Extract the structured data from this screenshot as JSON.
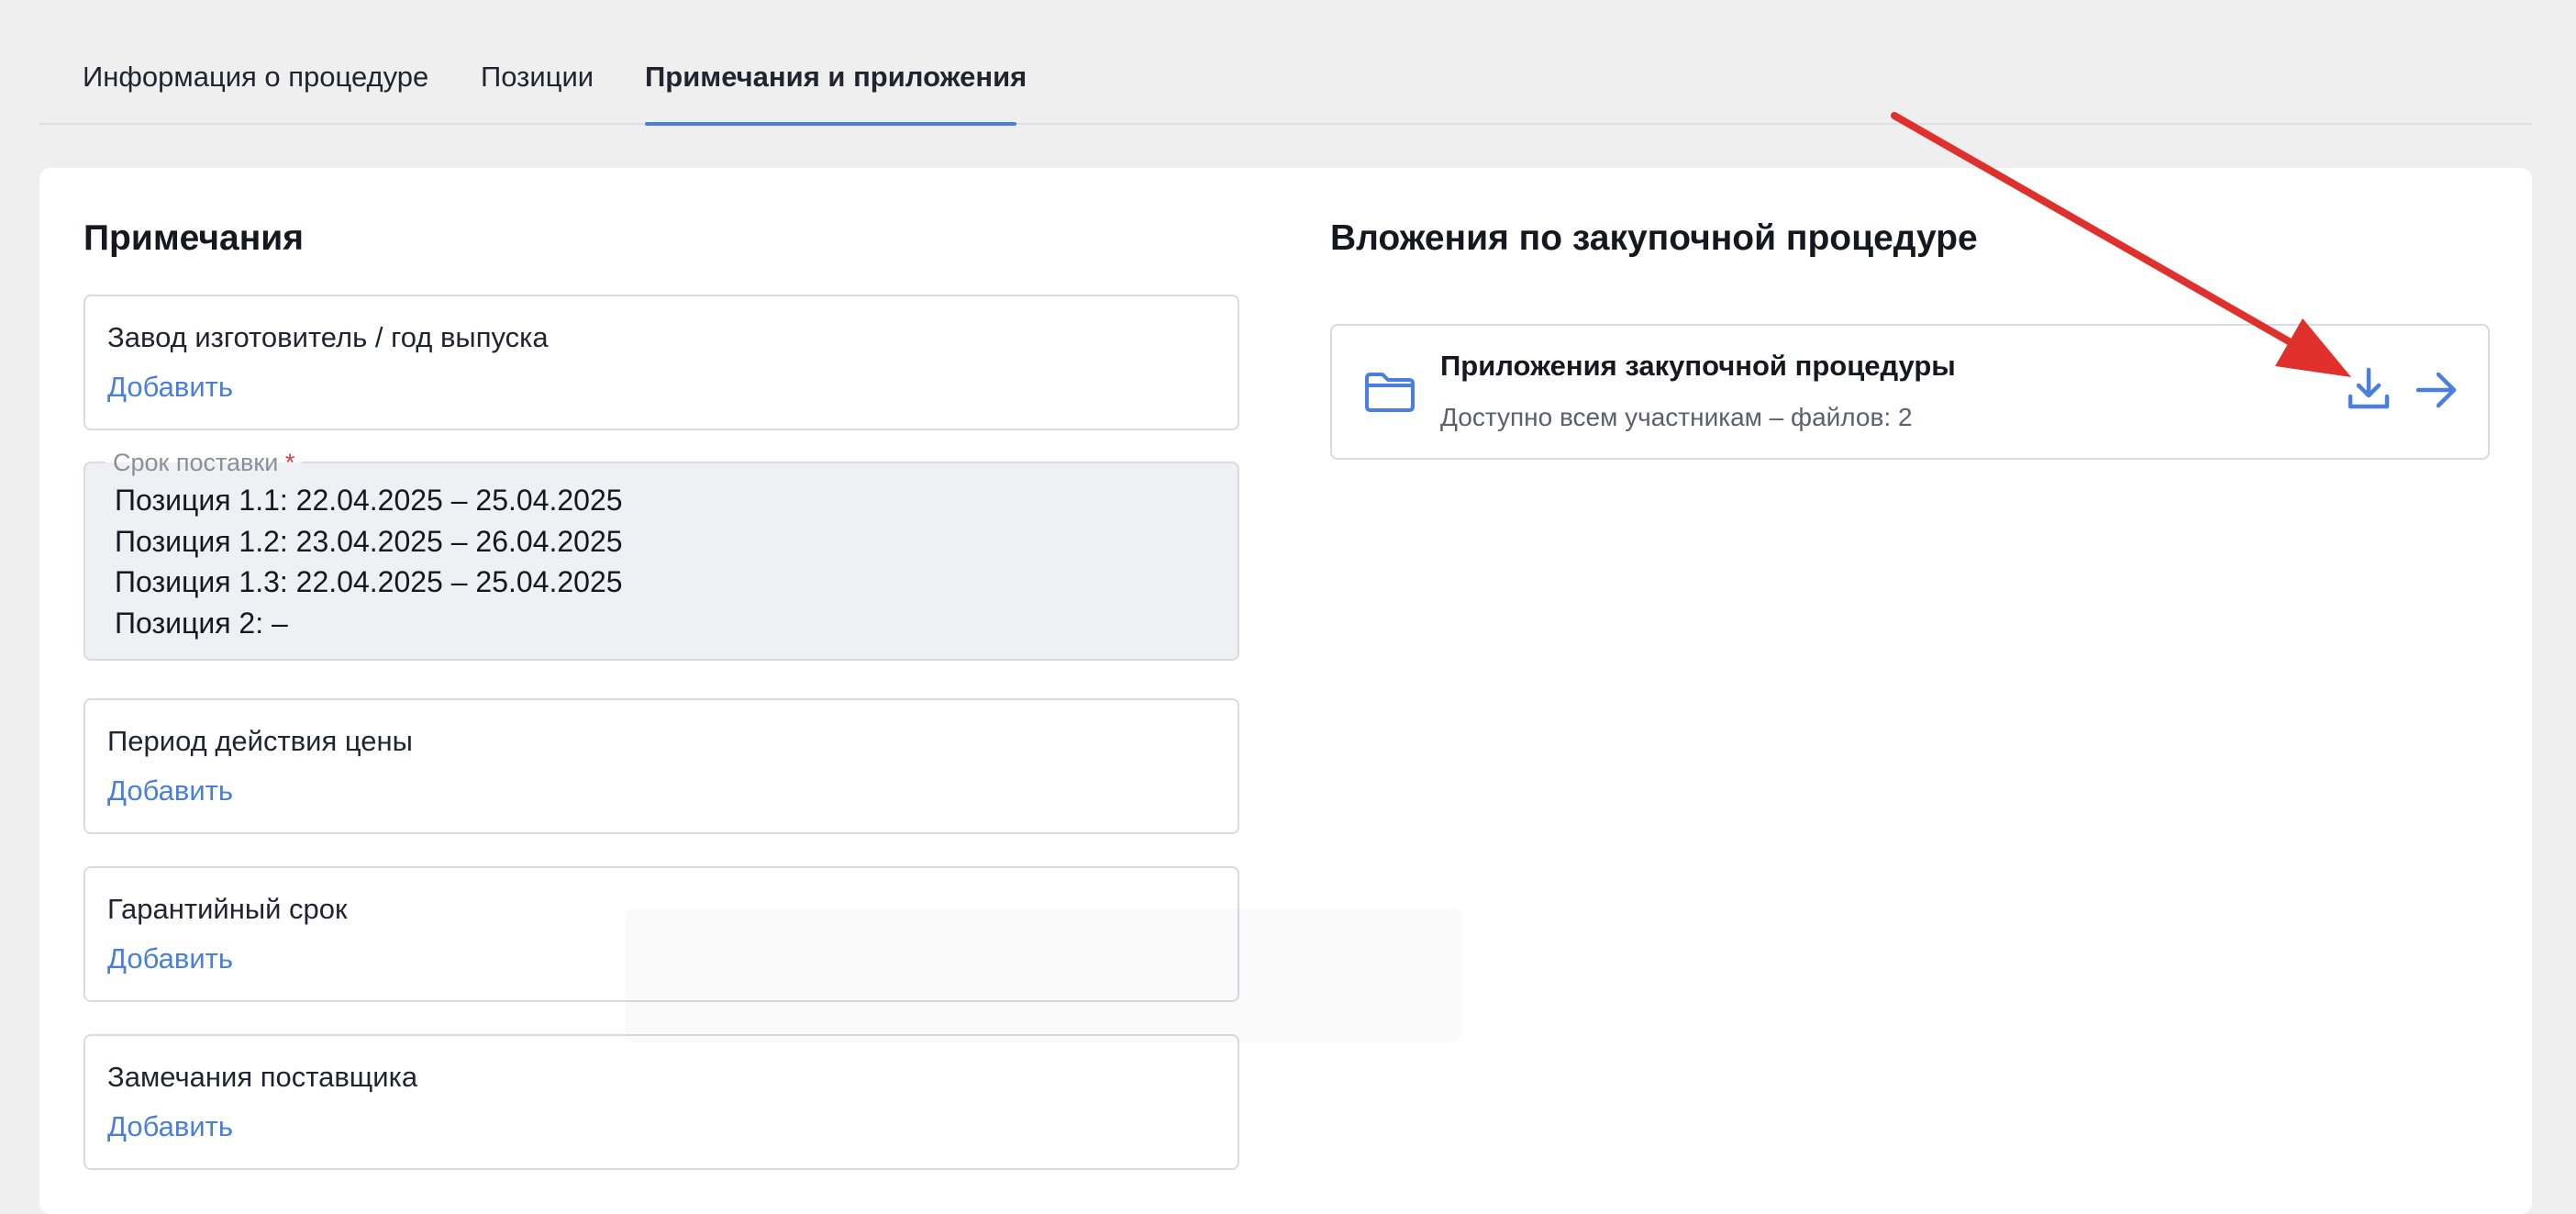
{
  "tabs": [
    {
      "label": "Информация о процедуре"
    },
    {
      "label": "Позиции"
    },
    {
      "label": "Примечания и приложения",
      "active": true
    }
  ],
  "notes": {
    "title": "Примечания",
    "manufacturer": {
      "label": "Завод изготовитель / год выпуска",
      "action": "Добавить"
    },
    "delivery": {
      "label": "Срок поставки",
      "required_mark": "*",
      "lines": [
        "Позиция 1.1: 22.04.2025 – 25.04.2025",
        "Позиция 1.2: 23.04.2025 – 26.04.2025",
        "Позиция 1.3: 22.04.2025 – 25.04.2025",
        "Позиция 2: –"
      ]
    },
    "price_period": {
      "label": "Период действия цены",
      "action": "Добавить"
    },
    "warranty": {
      "label": "Гарантийный срок",
      "action": "Добавить"
    },
    "supplier_remarks": {
      "label": "Замечания поставщика",
      "action": "Добавить"
    }
  },
  "attachments": {
    "title": "Вложения по закупочной процедуре",
    "items": [
      {
        "name": "Приложения закупочной процедуры",
        "subtitle": "Доступно всем участникам – файлов: 2",
        "icons": [
          "folder-icon",
          "download-icon",
          "arrow-right-icon"
        ]
      }
    ]
  },
  "colors": {
    "accent": "#4a7fe0",
    "link": "#4a7fd8",
    "required": "#d6383e",
    "annotation": "#e0302b",
    "background": "#efefef"
  }
}
